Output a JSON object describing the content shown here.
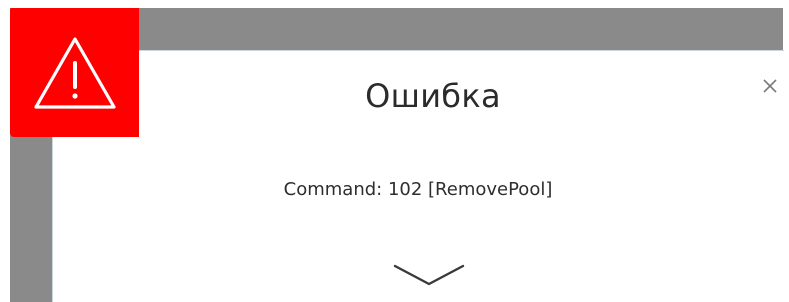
{
  "dialog": {
    "title": "Ошибка",
    "message": "Command: 102 [RemovePool]",
    "icon": "warning-triangle-icon",
    "close_icon": "close-icon",
    "expand_icon": "chevron-down-icon"
  },
  "colors": {
    "badge": "#ff0000",
    "backdrop": "#8a8a8a",
    "text": "#2b2b2b"
  }
}
